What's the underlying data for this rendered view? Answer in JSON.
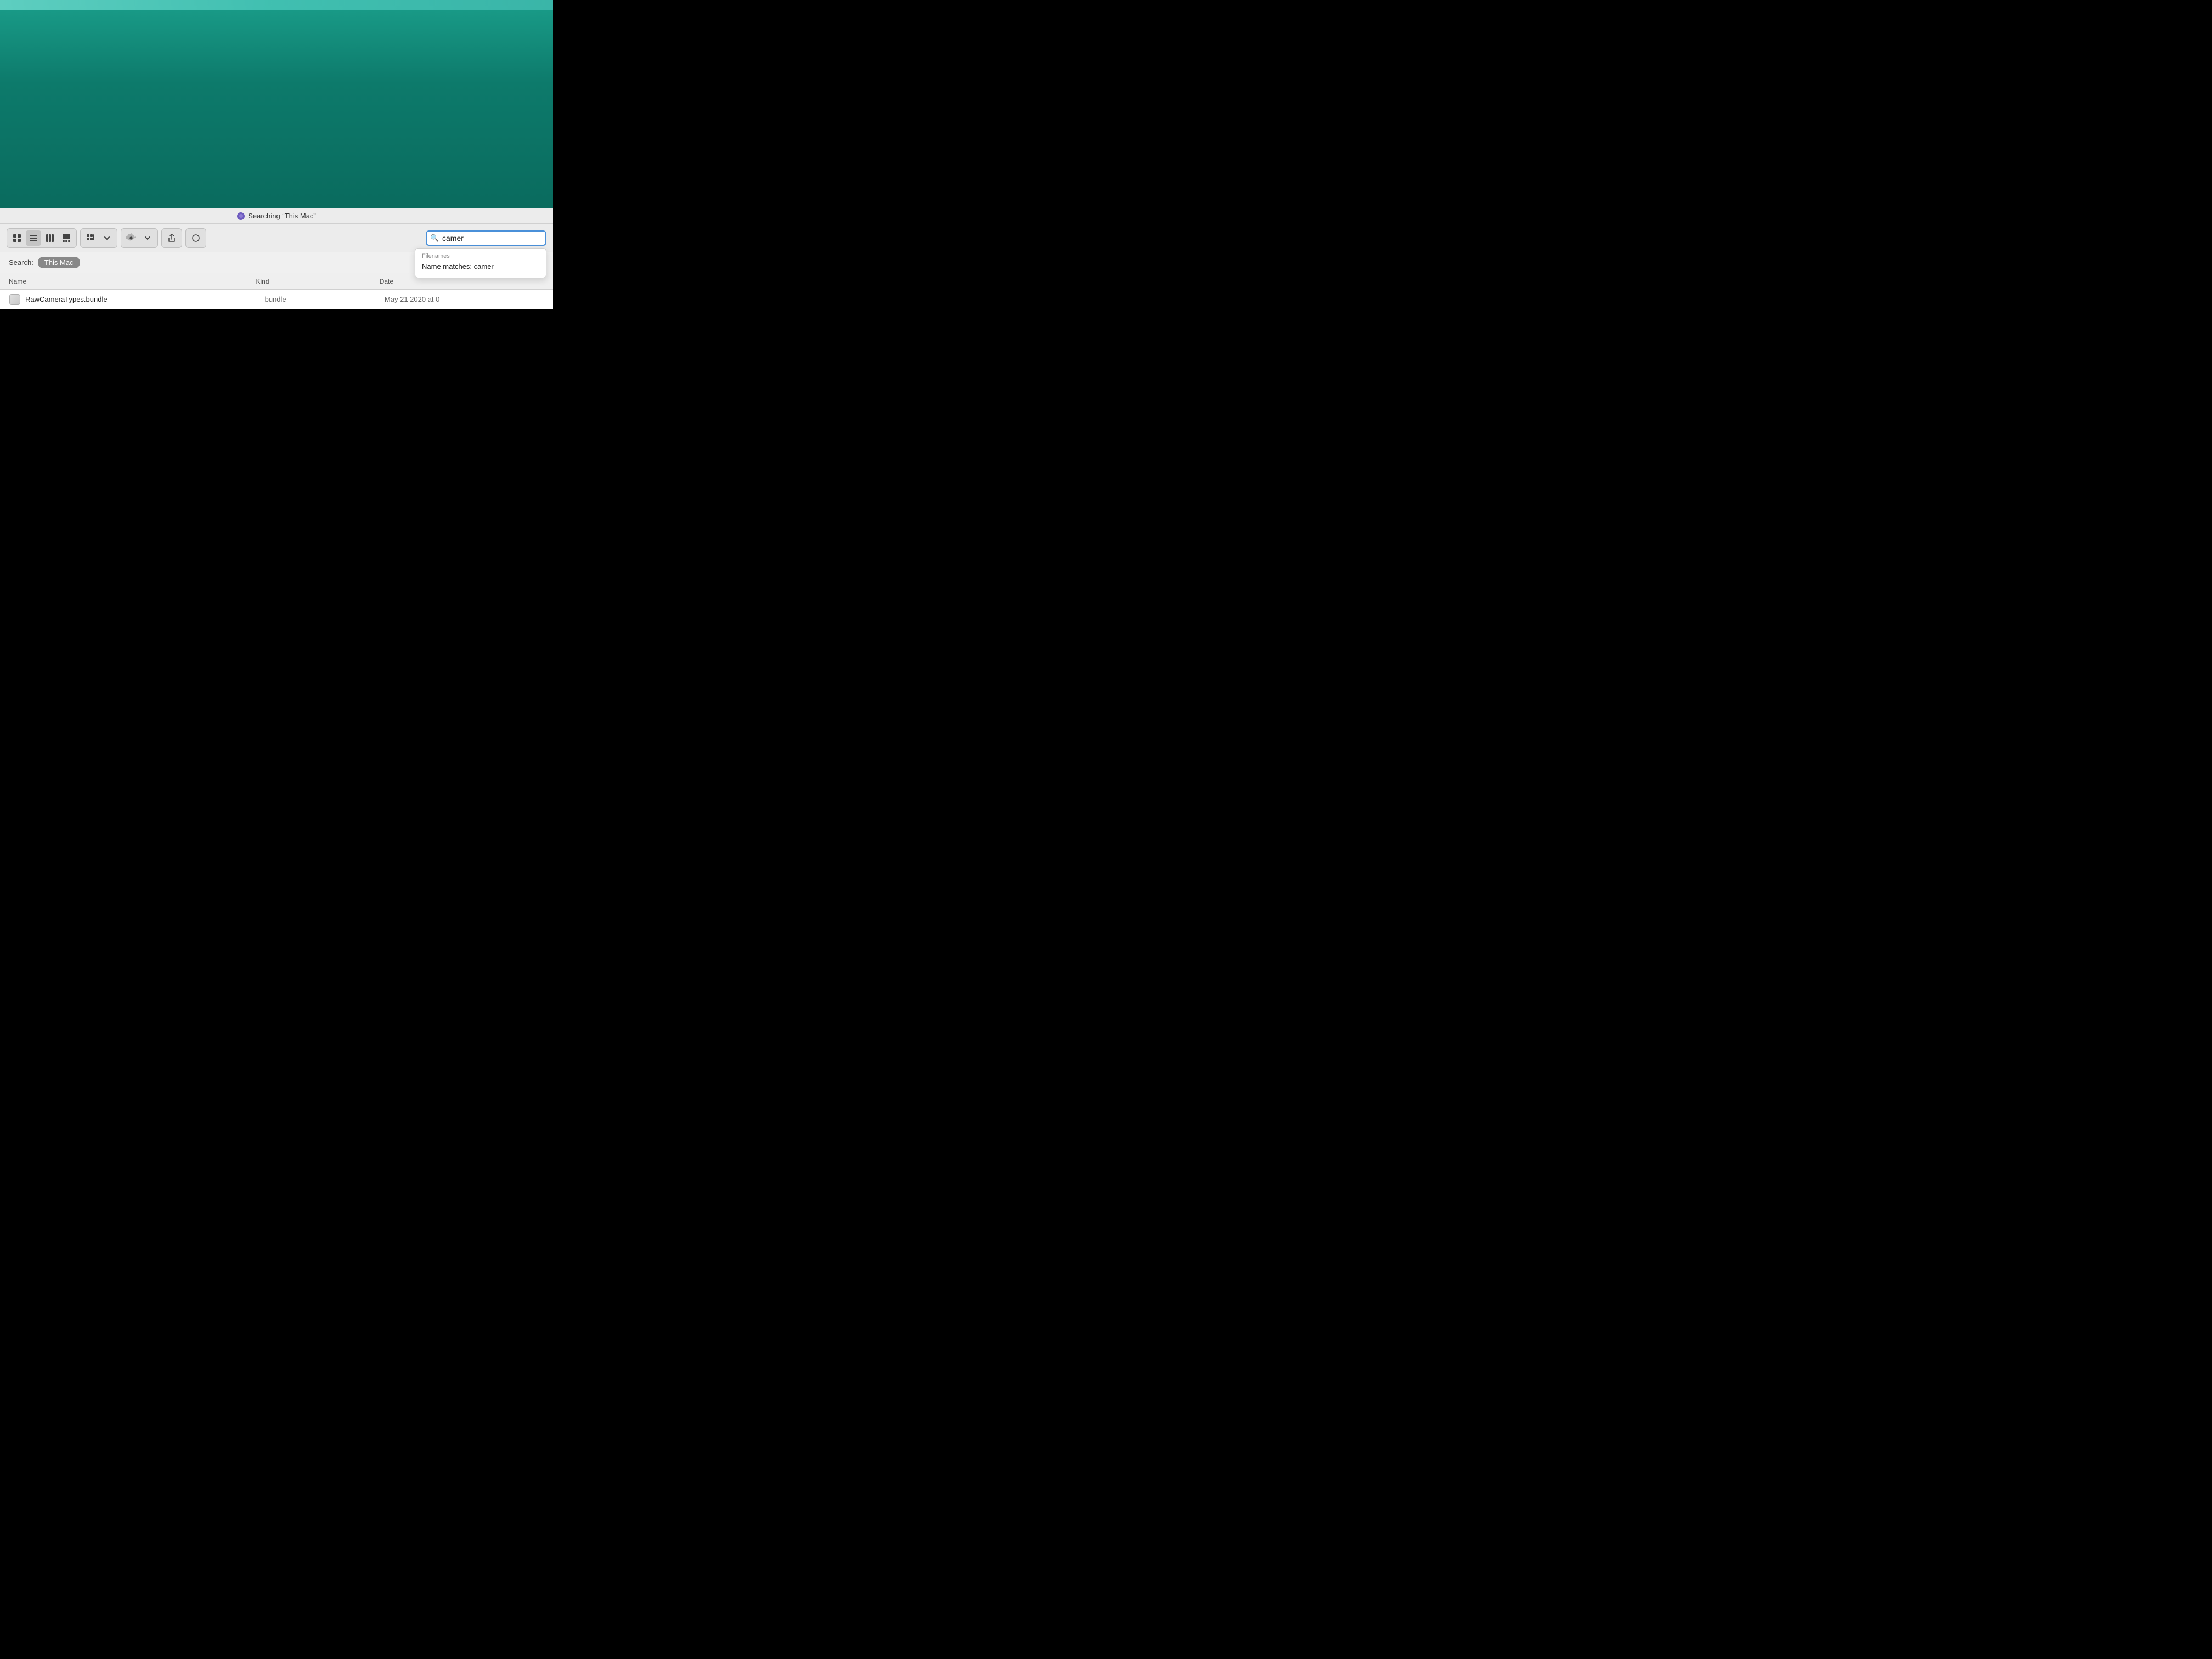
{
  "desktop": {
    "bg_color_top": "#5ecec0",
    "bg_color_main": "#0d7a6b"
  },
  "toolbar": {
    "searching_label": "Searching “This Mac”",
    "view_buttons": [
      {
        "id": "icon-view",
        "icon": "⊞",
        "label": "Icon View"
      },
      {
        "id": "list-view",
        "icon": "≡",
        "label": "List View",
        "active": true
      },
      {
        "id": "column-view",
        "icon": "⊟",
        "label": "Column View"
      },
      {
        "id": "gallery-view",
        "icon": "⊡",
        "label": "Gallery View"
      }
    ],
    "arrange_button": "⊞",
    "gear_label": "⚙",
    "share_label": "↑",
    "tag_label": "◯"
  },
  "search": {
    "value": "camer",
    "placeholder": "Search",
    "icon": "🔍",
    "dropdown": {
      "section_label": "Filenames",
      "match_item": "Name matches: camer"
    }
  },
  "scope_bar": {
    "label": "Search:",
    "active_scope": "This Mac"
  },
  "columns": {
    "name": "Name",
    "kind": "Kind",
    "date": "Date"
  },
  "files": [
    {
      "name": "RawCameraTypes.bundle",
      "kind": "bundle",
      "date": "May  21 2020 at 0"
    }
  ]
}
